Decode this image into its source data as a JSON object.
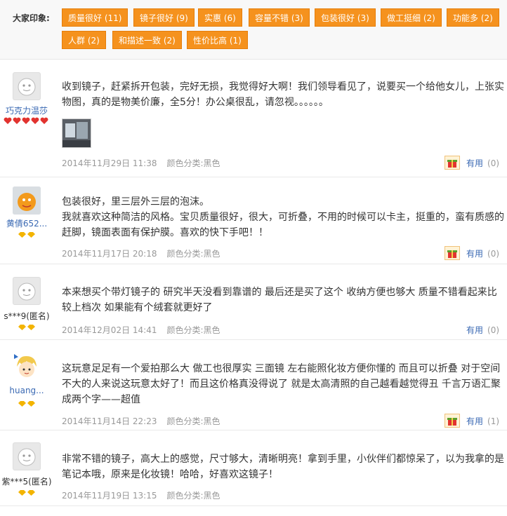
{
  "impressions": {
    "label": "大家印象:",
    "tags": [
      "质量很好 (11)",
      "镜子很好 (9)",
      "实惠 (6)",
      "容量不错 (3)",
      "包装很好 (3)",
      "做工挺细 (2)",
      "功能多 (2)",
      "人群 (2)",
      "和描述一致 (2)",
      "性价比高 (1)"
    ]
  },
  "reviews": [
    {
      "user": "巧克力温莎",
      "text": "收到镜子，赶紧拆开包装，完好无损，我觉得好大啊！我们领导看见了，说要买一个给他女儿，上张实物图，真的是物美价廉，全5分！办公桌很乱，请忽视。。。。。。",
      "date": "2014年11月29日 11:38",
      "color": "颜色分类:黑色",
      "useful_label": "有用",
      "useful_count": "(0)"
    },
    {
      "user": "黄倩652...",
      "text": "包装很好，里三层外三层的泡沫。\n我就喜欢这种简洁的风格。宝贝质量很好，很大，可折叠，不用的时候可以卡主，挺重的，蛮有质感的赶脚，镜面表面有保护膜。喜欢的快下手吧！！",
      "date": "2014年11月17日 20:18",
      "color": "颜色分类:黑色",
      "useful_label": "有用",
      "useful_count": "(0)"
    },
    {
      "user": "s***9(匿名)",
      "text": "本来想买个带灯镜子的 研究半天没看到靠谱的 最后还是买了这个 收纳方便也够大 质量不错看起来比较上档次 如果能有个绒套就更好了",
      "date": "2014年12月02日 14:41",
      "color": "颜色分类:黑色",
      "useful_label": "有用",
      "useful_count": "(0)"
    },
    {
      "user": "huang...",
      "text": "这玩意足足有一个爱拍那么大 做工也很厚实 三面镜 左右能照化妆方便你懂的 而且可以折叠 对于空间不大的人来说这玩意太好了！而且这价格真没得说了 就是太高清照的自己越看越觉得丑 千言万语汇聚成两个字——超值",
      "date": "2014年11月14日 22:23",
      "color": "颜色分类:黑色",
      "useful_label": "有用",
      "useful_count": "(1)"
    },
    {
      "user": "紫***5(匿名)",
      "text": "非常不错的镜子，高大上的感觉，尺寸够大，清晰明亮！拿到手里，小伙伴们都惊呆了，以为我拿的是笔记本哦，原来是化妆镜！哈哈，好喜欢这镜子！",
      "date": "2014年11月19日 13:15",
      "color": "颜色分类:黑色",
      "useful_label": "有用",
      "useful_count": "(0)"
    }
  ],
  "colors": {
    "tag_bg": "#f5921e",
    "link": "#3a69b3",
    "meta": "#999999",
    "heart": "#e2332f",
    "diamond": "#f3b400"
  }
}
